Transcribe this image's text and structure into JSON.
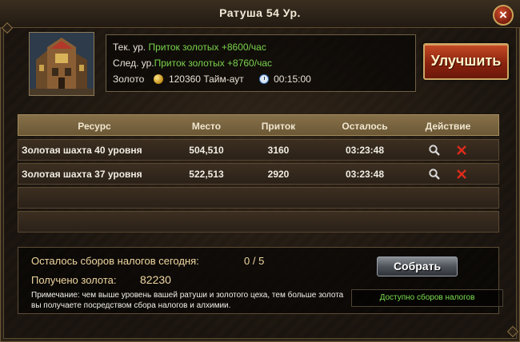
{
  "window": {
    "title": "Ратуша 54 Ур.",
    "close_label": "×"
  },
  "info": {
    "current_prefix": "Тек. ур.",
    "current_value": "Приток золотых +8600/час",
    "next_prefix": "След. ур.",
    "next_value": "Приток золотых +8760/час",
    "gold_label": "Золото",
    "gold_amount": "120360",
    "timeout_label": "Тайм-аут",
    "time": "00:15:00"
  },
  "upgrade_button": "Улучшить",
  "table": {
    "headers": [
      "Ресурс",
      "Место",
      "Приток",
      "Осталось",
      "Действие"
    ],
    "rows": [
      {
        "resource": "Золотая шахта 40 уровня",
        "place": "504,510",
        "inflow": "3160",
        "remaining": "03:23:48"
      },
      {
        "resource": "Золотая шахта 37 уровня",
        "place": "522,513",
        "inflow": "2920",
        "remaining": "03:23:48"
      }
    ],
    "empty_rows": 2
  },
  "collection": {
    "remaining_label": "Осталось сборов налогов сегодня:",
    "remaining_count": "0 / 5",
    "gold_label": "Получено золота:",
    "gold_value": "82230",
    "note": "Примечание: чем выше уровень вашей ратуши и золотого цеха, тем больше золота вы получаете посредством сбора налогов и алхимии.",
    "collect_button": "Собрать",
    "available_label": "Доступно сборов налогов"
  },
  "colors": {
    "accent_green": "#79d34c",
    "upgrade_red": "#8b230f",
    "header_tan": "#86714a"
  }
}
